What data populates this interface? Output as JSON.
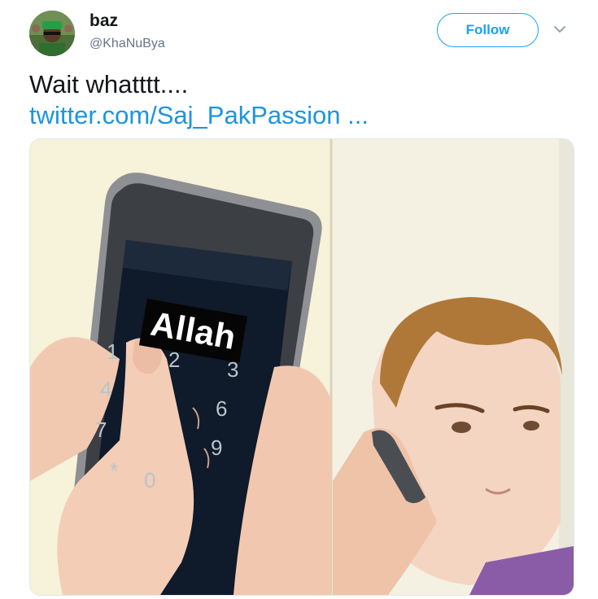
{
  "author": {
    "name": "baz",
    "handle": "@KhaNuBya",
    "avatar_icon": "profile-photo"
  },
  "header": {
    "follow_label": "Follow",
    "menu_icon": "chevron-down-icon"
  },
  "tweet": {
    "text": "Wait whatttt....",
    "link": "twitter.com/Saj_PakPassion ..."
  },
  "media": {
    "caption_on_phone": "Allah",
    "keypad": [
      "1",
      "2",
      "3",
      "4",
      "6",
      "7",
      "9",
      "*",
      "0"
    ]
  },
  "colors": {
    "accent": "#1da1f2",
    "link": "#1b95e0",
    "text": "#14171a",
    "secondary_text": "#657786"
  }
}
